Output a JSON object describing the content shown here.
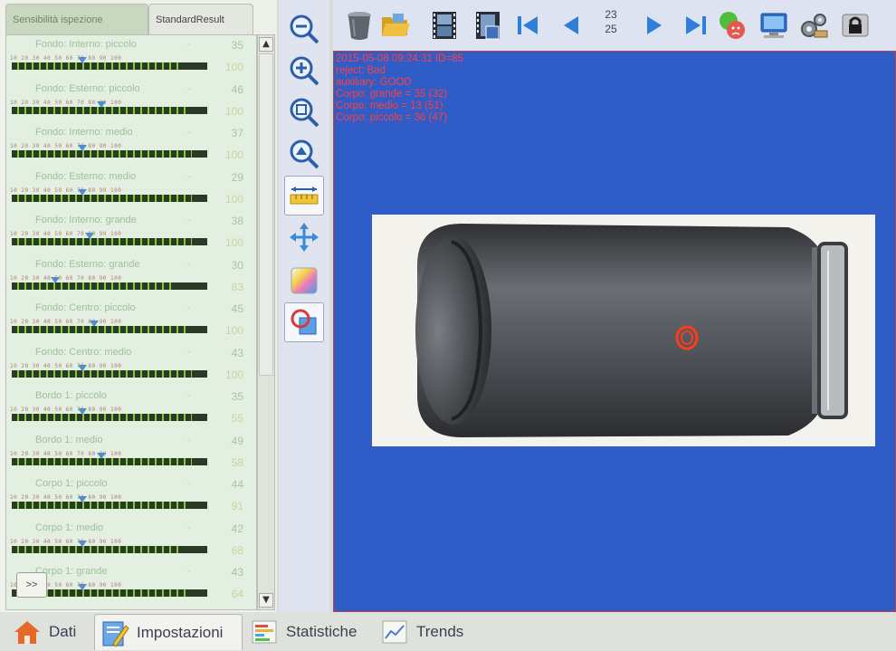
{
  "left_panel": {
    "tabs": [
      {
        "label": "Sensibilità ispezione",
        "active": true
      },
      {
        "label": "StandardResult",
        "active": false
      }
    ],
    "rows": [
      {
        "name": "Fondo: Interno: piccolo",
        "max": "35",
        "value": "100",
        "fill": 0.86,
        "marker": 0.36
      },
      {
        "name": "Fondo: Esterno: piccolo",
        "max": "46",
        "value": "100",
        "fill": 0.9,
        "marker": 0.46
      },
      {
        "name": "Fondo: Interno: medio",
        "max": "37",
        "value": "100",
        "fill": 0.92,
        "marker": 0.36
      },
      {
        "name": "Fondo: Esterno: medio",
        "max": "29",
        "value": "100",
        "fill": 0.92,
        "marker": 0.36
      },
      {
        "name": "Fondo: Interno: grande",
        "max": "38",
        "value": "100",
        "fill": 0.92,
        "marker": 0.4
      },
      {
        "name": "Fondo: Esterno: grande",
        "max": "30",
        "value": "83",
        "fill": 0.82,
        "marker": 0.22
      },
      {
        "name": "Fondo: Centro: piccolo",
        "max": "45",
        "value": "100",
        "fill": 0.9,
        "marker": 0.42
      },
      {
        "name": "Fondo: Centro: medio",
        "max": "43",
        "value": "100",
        "fill": 0.92,
        "marker": 0.36
      },
      {
        "name": "Bordo 1: piccolo",
        "max": "35",
        "value": "55",
        "fill": 0.92,
        "marker": 0.36
      },
      {
        "name": "Bordo 1: medio",
        "max": "49",
        "value": "58",
        "fill": 0.92,
        "marker": 0.46
      },
      {
        "name": "Corpo 1: piccolo",
        "max": "44",
        "value": "91",
        "fill": 0.9,
        "marker": 0.36
      },
      {
        "name": "Corpo 1: medio",
        "max": "42",
        "value": "68",
        "fill": 0.88,
        "marker": 0.36
      },
      {
        "name": "Corpo 1: grande",
        "max": "43",
        "value": "64",
        "fill": 0.9,
        "marker": 0.36
      }
    ],
    "ticks": "10 20 30 40 50 60 70 80 90 100",
    "minus": "-",
    "expand_label": ">>",
    "scroll_up": "▲",
    "scroll_down": "▼"
  },
  "toolbar": {
    "counter_top": "23",
    "counter_bottom": "25"
  },
  "image_view": {
    "overlay_lines": [
      "2015-05-08 09:24:31 ID=85",
      "reject: Bad",
      "auxiliary: GOOD",
      "Corpo: grande = 35 (32)",
      "Corpo: medio = 13 (51)",
      "Corpo: piccolo = 36 (47)"
    ]
  },
  "bottom_nav": {
    "tabs": [
      {
        "label": "Dati",
        "icon": "home-icon"
      },
      {
        "label": "Impostazioni",
        "icon": "settings-icon",
        "active": true
      },
      {
        "label": "Statistiche",
        "icon": "statistics-icon"
      },
      {
        "label": "Trends",
        "icon": "trend-icon"
      }
    ]
  },
  "colors": {
    "accent_green": "#7ccf3a",
    "image_bg": "#2f5cc6",
    "overlay_red": "#ff4040",
    "defect_red": "#ff3b1a"
  }
}
